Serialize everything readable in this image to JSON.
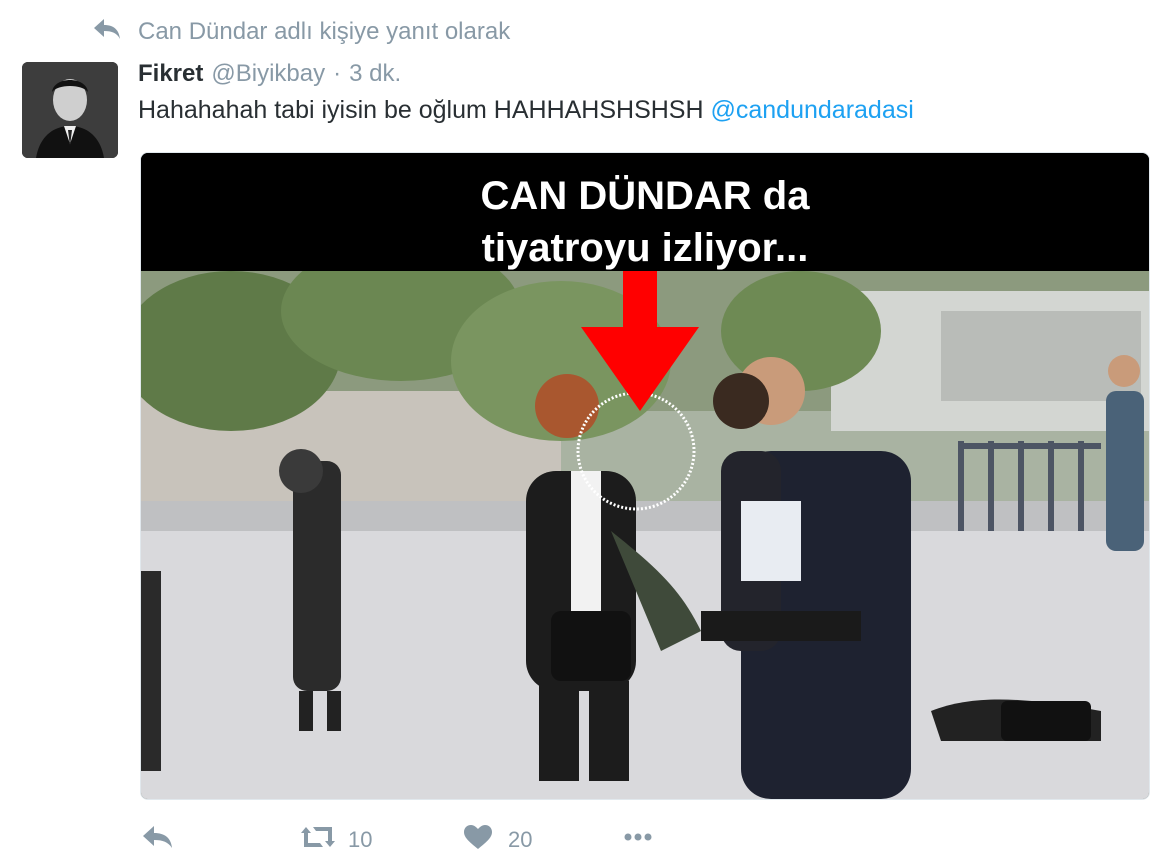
{
  "context": {
    "reply_to_text": "Can Dündar adlı kişiye yanıt olarak",
    "icon": "reply-icon"
  },
  "tweet": {
    "display_name": "Fikret",
    "handle": "@Biyikbay",
    "separator": "·",
    "time": "3 dk.",
    "text_before": "Hahahahah tabi iyisin be oğlum HAHHAHSHSHSH ",
    "mention": "@candundaradasi",
    "avatar": "avatar-photo"
  },
  "media": {
    "caption_line1": "CAN DÜNDAR da",
    "caption_line2": "tiyatroyu izliyor...",
    "arrow_color": "#ff0000"
  },
  "actions": {
    "reply_icon": "reply-icon",
    "retweet_icon": "retweet-icon",
    "retweet_count": "10",
    "like_icon": "heart-icon",
    "like_count": "20",
    "more_icon": "more-icon"
  },
  "colors": {
    "accent": "#1da1f2",
    "muted": "#8899a6",
    "text": "#292f33"
  }
}
